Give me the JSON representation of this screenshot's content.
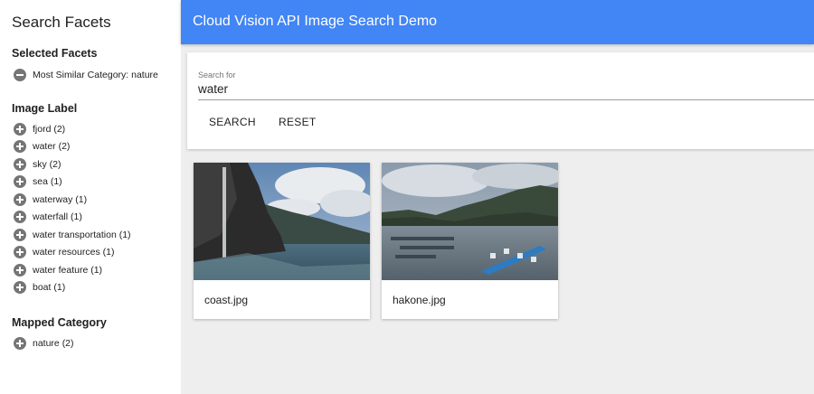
{
  "sidebar": {
    "title": "Search Facets",
    "selected_title": "Selected Facets",
    "selected": [
      {
        "label": "Most Similar Category: nature"
      }
    ],
    "image_label_title": "Image Label",
    "image_labels": [
      {
        "label": "fjord (2)"
      },
      {
        "label": "water (2)"
      },
      {
        "label": "sky (2)"
      },
      {
        "label": "sea (1)"
      },
      {
        "label": "waterway (1)"
      },
      {
        "label": "waterfall (1)"
      },
      {
        "label": "water transportation (1)"
      },
      {
        "label": "water resources (1)"
      },
      {
        "label": "water feature (1)"
      },
      {
        "label": "boat (1)"
      }
    ],
    "mapped_category_title": "Mapped Category",
    "mapped_categories": [
      {
        "label": "nature (2)"
      }
    ]
  },
  "header": {
    "title": "Cloud Vision API Image Search Demo"
  },
  "search": {
    "label": "Search for",
    "value": "water",
    "search_button": "SEARCH",
    "reset_button": "RESET"
  },
  "results": [
    {
      "caption": "coast.jpg"
    },
    {
      "caption": "hakone.jpg"
    }
  ],
  "colors": {
    "app_bar": "#4285f4",
    "background": "#eeeeee",
    "facet_icon": "#757575"
  }
}
